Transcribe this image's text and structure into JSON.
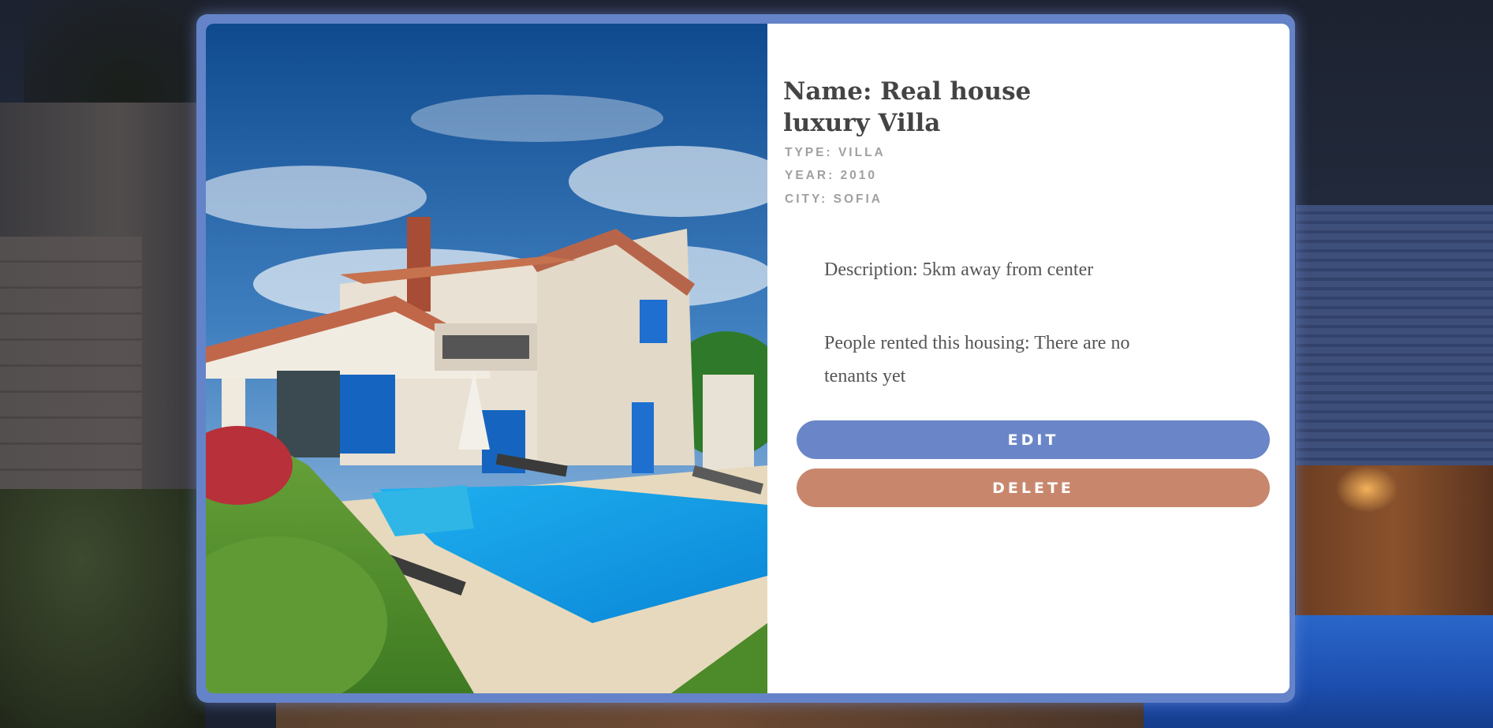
{
  "listing": {
    "name": "Name: Real house luxury Villa",
    "type": "TYPE: VILLA",
    "year": "YEAR: 2010",
    "city": "CITY: SOFIA",
    "description": "Description: 5km away from center",
    "tenants": "People rented this housing: There are no tenants yet"
  },
  "actions": {
    "edit_label": "EDIT",
    "delete_label": "DELETE"
  },
  "colors": {
    "card_border": "#6583c8",
    "edit_button": "#6a86c8",
    "delete_button": "#c8876d"
  },
  "icons": {
    "photo": "villa-photo"
  }
}
